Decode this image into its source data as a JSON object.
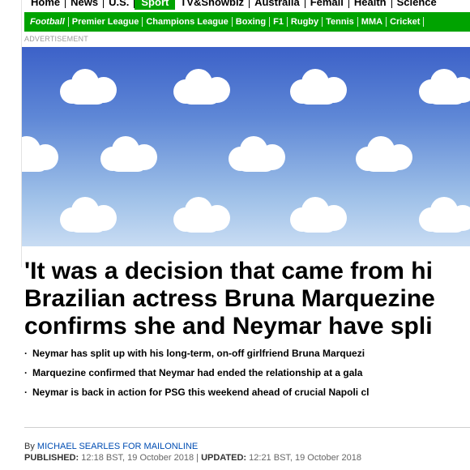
{
  "topnav": {
    "items": [
      "Home",
      "News",
      "U.S.",
      "Sport",
      "TV&Showbiz",
      "Australia",
      "Femail",
      "Health",
      "Science"
    ],
    "active": "Sport"
  },
  "subnav": {
    "items": [
      "Football",
      "Premier League",
      "Champions League",
      "Boxing",
      "F1",
      "Rugby",
      "Tennis",
      "MMA",
      "Cricket"
    ]
  },
  "ad": {
    "label": "ADVERTISEMENT"
  },
  "article": {
    "headline_lines": [
      "'It was a decision that came from hi",
      "Brazilian actress Bruna Marquezine",
      "confirms she and Neymar have spli"
    ],
    "bullets": [
      "Neymar has split up with his long-term, on-off girlfriend Bruna Marquezi",
      "Marquezine confirmed that Neymar had ended the relationship at a gala",
      "Neymar is back in action for PSG this weekend ahead of crucial Napoli cl"
    ],
    "byline_prefix": "By ",
    "author": "MICHAEL SEARLES FOR MAILONLINE",
    "published_label": "PUBLISHED:",
    "published_value": " 12:18 BST, 19 October 2018 | ",
    "updated_label": "UPDATED:",
    "updated_value": " 12:21 BST, 19 October 2018"
  },
  "colors": {
    "sport_green": "#00a300",
    "author_blue": "#004db3",
    "sky_top": "#3c61c8",
    "sky_bottom": "#c8dcf3"
  }
}
